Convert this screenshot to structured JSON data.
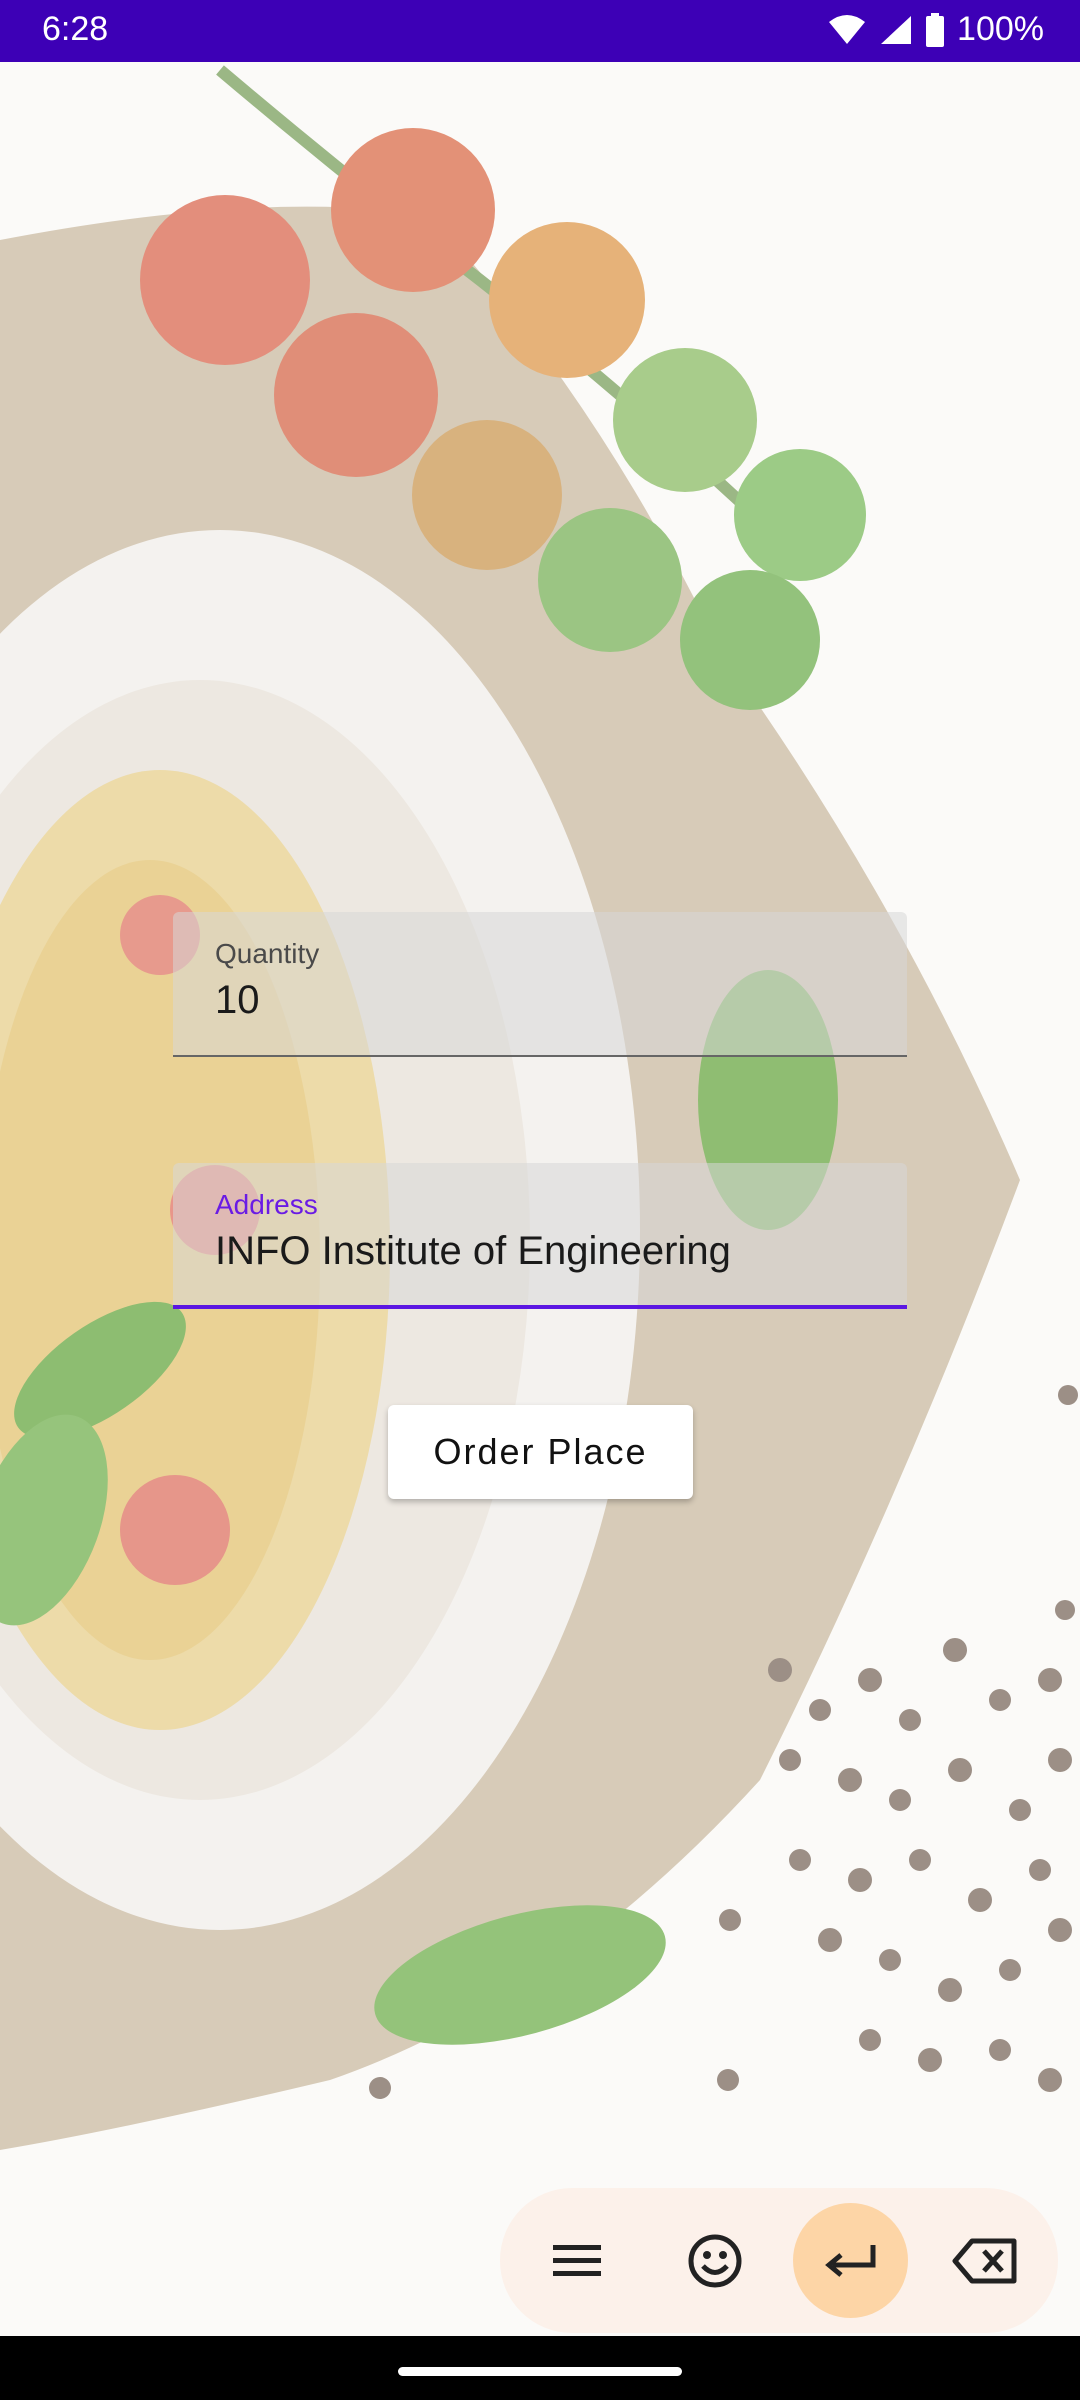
{
  "status_bar": {
    "time": "6:28",
    "battery": "100%",
    "icons": [
      "wifi-icon",
      "signal-icon",
      "battery-icon"
    ]
  },
  "form": {
    "quantity": {
      "label": "Quantity",
      "value": "10"
    },
    "address": {
      "label": "Address",
      "value": "INFO Institute of Engineering"
    },
    "order_button_label": "Order Place"
  },
  "keyboard_toolbar": {
    "keys": [
      "menu-icon",
      "emoji-icon",
      "enter-icon",
      "backspace-icon"
    ]
  },
  "colors": {
    "status_bar": "#3d00b6",
    "accent": "#5b17e2",
    "ime_bar": "#fcf1ea",
    "ime_active": "#fdd5a6"
  }
}
